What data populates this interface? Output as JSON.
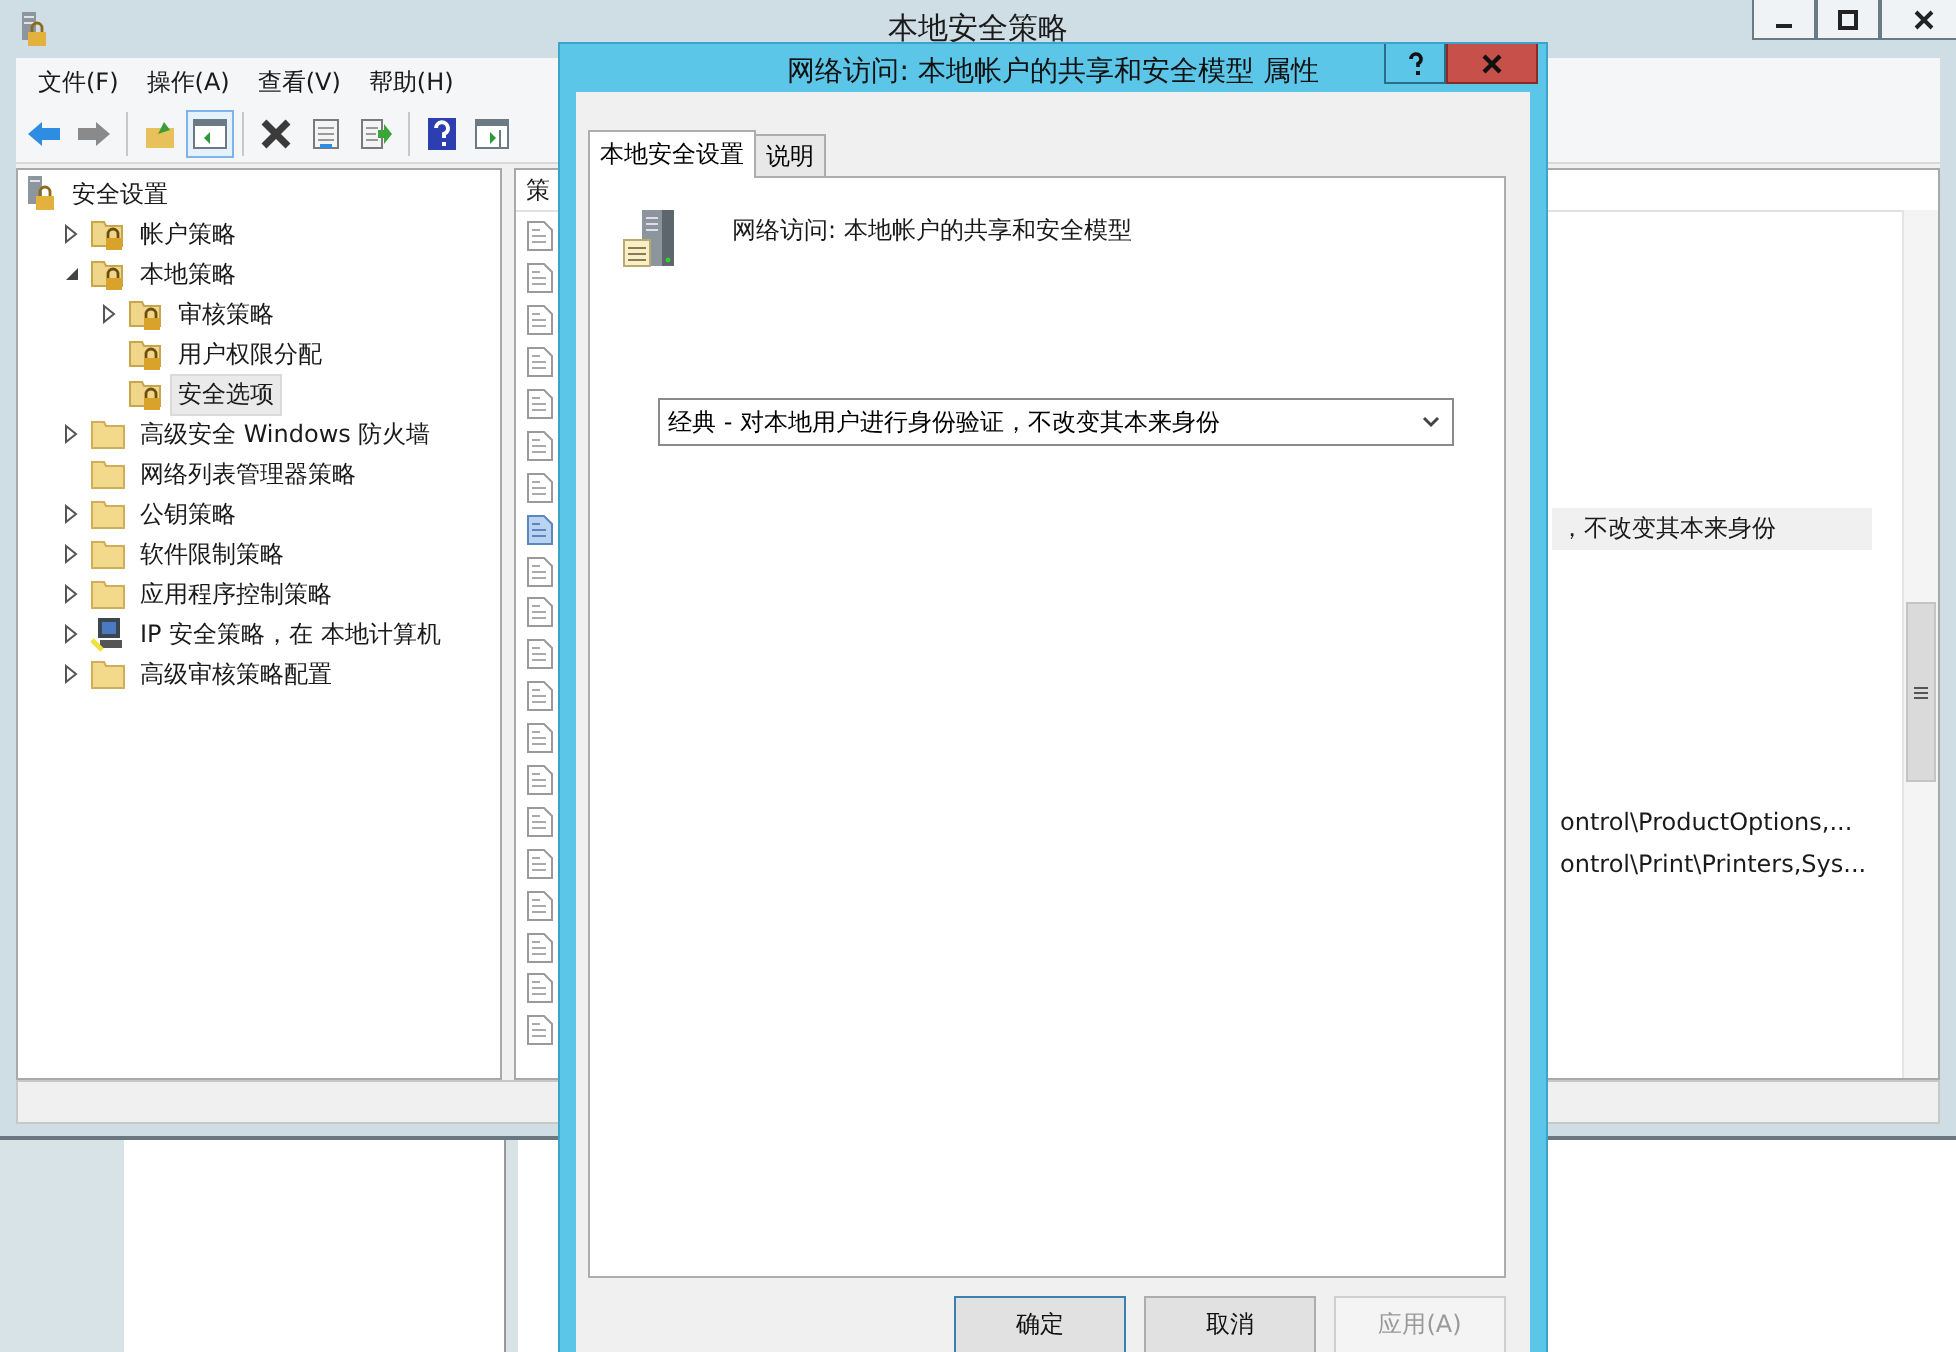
{
  "window": {
    "title": "本地安全策略"
  },
  "menu": [
    "文件(F)",
    "操作(A)",
    "查看(V)",
    "帮助(H)"
  ],
  "toolbar": [
    {
      "kind": "back",
      "pressed": false,
      "disabled": false
    },
    {
      "kind": "forward",
      "pressed": false,
      "disabled": true
    },
    {
      "kind": "up",
      "pressed": false,
      "disabled": false
    },
    {
      "kind": "tree",
      "pressed": true,
      "disabled": false
    },
    {
      "kind": "delete",
      "pressed": false,
      "disabled": false
    },
    {
      "kind": "properties",
      "pressed": false,
      "disabled": false
    },
    {
      "kind": "export",
      "pressed": false,
      "disabled": false
    },
    {
      "kind": "help",
      "pressed": false,
      "disabled": false
    },
    {
      "kind": "pane",
      "pressed": false,
      "disabled": false
    }
  ],
  "tree": {
    "label": "安全设置",
    "kind": "security",
    "selected": false,
    "children": [
      {
        "label": "帐户策略",
        "kind": "lock-folder",
        "expanded": false,
        "selected": false
      },
      {
        "label": "本地策略",
        "kind": "lock-folder",
        "expanded": true,
        "selected": false,
        "children": [
          {
            "label": "审核策略",
            "kind": "lock-folder",
            "expanded": false,
            "selected": false
          },
          {
            "label": "用户权限分配",
            "kind": "lock-folder",
            "selected": false
          },
          {
            "label": "安全选项",
            "kind": "lock-folder",
            "selected": true
          }
        ]
      },
      {
        "label": "高级安全 Windows 防火墙",
        "kind": "folder",
        "expanded": false,
        "selected": false
      },
      {
        "label": "网络列表管理器策略",
        "kind": "folder",
        "selected": false
      },
      {
        "label": "公钥策略",
        "kind": "folder",
        "expanded": false,
        "selected": false
      },
      {
        "label": "软件限制策略",
        "kind": "folder",
        "expanded": false,
        "selected": false
      },
      {
        "label": "应用程序控制策略",
        "kind": "folder",
        "expanded": false,
        "selected": false
      },
      {
        "label": "IP 安全策略，在 本地计算机",
        "kind": "ip",
        "expanded": false,
        "selected": false
      },
      {
        "label": "高级审核策略配置",
        "kind": "folder",
        "expanded": false,
        "selected": false
      }
    ]
  },
  "list": {
    "column": "策",
    "rows": [
      {
        "selected": false
      },
      {
        "selected": false
      },
      {
        "selected": false
      },
      {
        "selected": false
      },
      {
        "selected": false
      },
      {
        "selected": false
      },
      {
        "selected": false
      },
      {
        "selected": true,
        "value": "，不改变其本来身份"
      },
      {
        "selected": false
      },
      {
        "selected": false
      },
      {
        "selected": false
      },
      {
        "selected": false
      },
      {
        "selected": false
      },
      {
        "selected": false
      },
      {
        "selected": false,
        "value": "ontrol\\ProductOptions,..."
      },
      {
        "selected": false,
        "value": "ontrol\\Print\\Printers,Sys..."
      },
      {
        "selected": false
      },
      {
        "selected": false
      },
      {
        "selected": false
      },
      {
        "selected": false
      }
    ]
  },
  "dialog": {
    "title": "网络访问: 本地帐户的共享和安全模型 属性",
    "tabs": [
      {
        "label": "本地安全设置",
        "selected": true
      },
      {
        "label": "说明",
        "selected": false
      }
    ],
    "policy_name": "网络访问: 本地帐户的共享和安全模型",
    "dropdown": {
      "value": "经典 - 对本地用户进行身份验证，不改变其本来身份"
    },
    "buttons": [
      {
        "label": "确定",
        "default": true,
        "disabled": false
      },
      {
        "label": "取消",
        "default": false,
        "disabled": false
      },
      {
        "label": "应用(A)",
        "default": false,
        "disabled": true
      }
    ]
  }
}
